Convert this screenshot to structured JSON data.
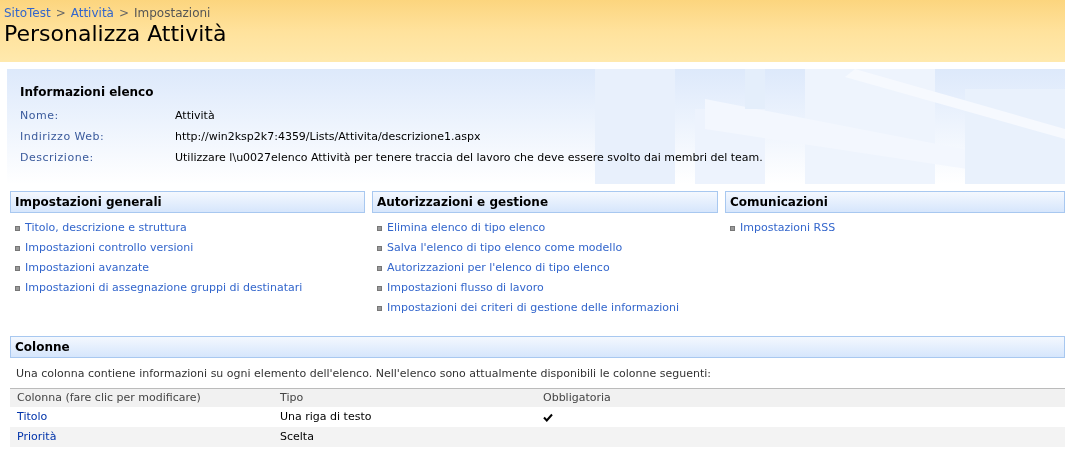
{
  "breadcrumb": [
    {
      "label": "SitoTest",
      "link": true
    },
    {
      "label": "Attività",
      "link": true
    },
    {
      "label": "Impostazioni",
      "link": false
    }
  ],
  "breadcrumb_separator": ">",
  "page_title": "Personalizza Attività",
  "list_info": {
    "title": "Informazioni elenco",
    "fields": [
      {
        "label": "Nome:",
        "value": "Attività"
      },
      {
        "label": "Indirizzo Web:",
        "value": "http://win2ksp2k7:4359/Lists/Attivita/descrizione1.aspx"
      },
      {
        "label": "Descrizione:",
        "value": "Utilizzare l\\u0027elenco Attività per tenere traccia del lavoro che deve essere svolto dai membri del team."
      }
    ]
  },
  "sections": [
    {
      "title": "Impostazioni generali",
      "links": [
        "Titolo, descrizione e struttura",
        "Impostazioni controllo versioni",
        "Impostazioni avanzate",
        "Impostazioni di assegnazione gruppi di destinatari"
      ]
    },
    {
      "title": "Autorizzazioni e gestione",
      "links": [
        "Elimina elenco di tipo elenco",
        "Salva l'elenco di tipo elenco come modello",
        "Autorizzazioni per l'elenco di tipo elenco",
        "Impostazioni flusso di lavoro",
        "Impostazioni dei criteri di gestione delle informazioni"
      ]
    },
    {
      "title": "Comunicazioni",
      "links": [
        "Impostazioni RSS"
      ]
    }
  ],
  "columns_section": {
    "title": "Colonne",
    "description": "Una colonna contiene informazioni su ogni elemento dell'elenco. Nell'elenco sono attualmente disponibili le colonne seguenti:",
    "table": {
      "columns": [
        "Colonna (fare clic per modificare)",
        "Tipo",
        "Obbligatoria"
      ],
      "rows": [
        {
          "name": "Titolo",
          "type": "Una riga di testo",
          "required": true
        },
        {
          "name": "Priorità",
          "type": "Scelta",
          "required": false
        }
      ]
    }
  }
}
